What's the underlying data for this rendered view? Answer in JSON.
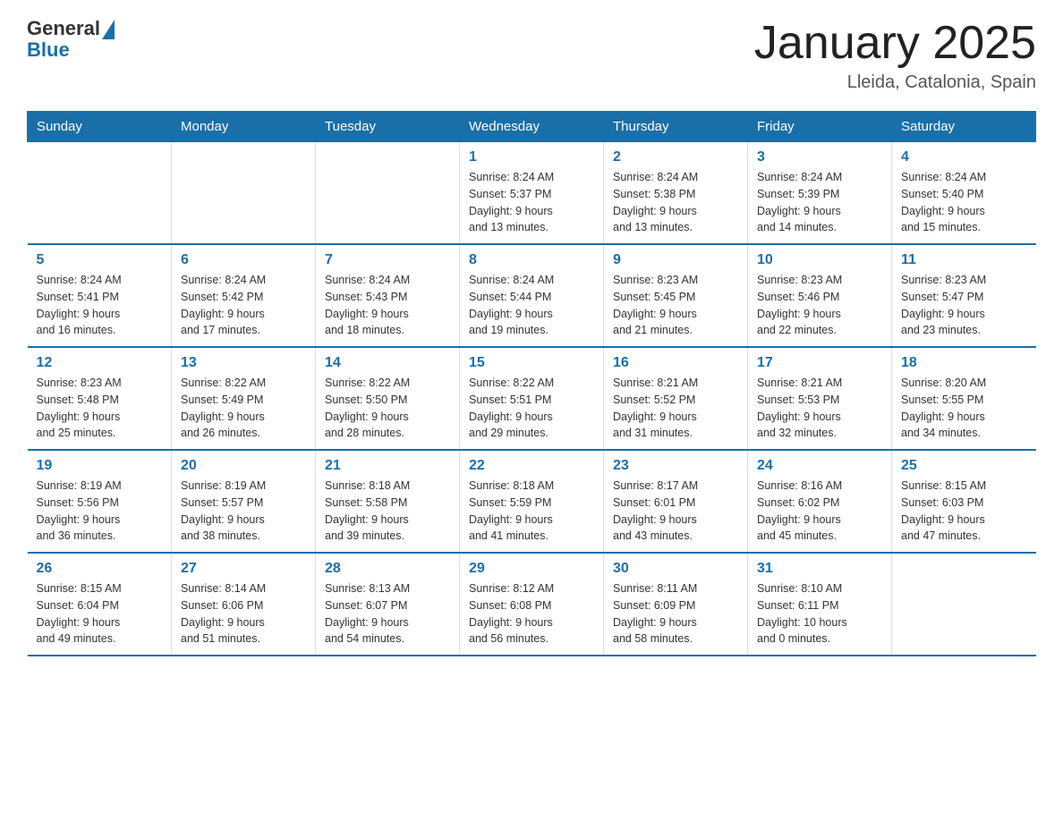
{
  "header": {
    "logo_general": "General",
    "logo_blue": "Blue",
    "main_title": "January 2025",
    "subtitle": "Lleida, Catalonia, Spain"
  },
  "calendar": {
    "days_of_week": [
      "Sunday",
      "Monday",
      "Tuesday",
      "Wednesday",
      "Thursday",
      "Friday",
      "Saturday"
    ],
    "weeks": [
      [
        {
          "day": "",
          "info": ""
        },
        {
          "day": "",
          "info": ""
        },
        {
          "day": "",
          "info": ""
        },
        {
          "day": "1",
          "info": "Sunrise: 8:24 AM\nSunset: 5:37 PM\nDaylight: 9 hours\nand 13 minutes."
        },
        {
          "day": "2",
          "info": "Sunrise: 8:24 AM\nSunset: 5:38 PM\nDaylight: 9 hours\nand 13 minutes."
        },
        {
          "day": "3",
          "info": "Sunrise: 8:24 AM\nSunset: 5:39 PM\nDaylight: 9 hours\nand 14 minutes."
        },
        {
          "day": "4",
          "info": "Sunrise: 8:24 AM\nSunset: 5:40 PM\nDaylight: 9 hours\nand 15 minutes."
        }
      ],
      [
        {
          "day": "5",
          "info": "Sunrise: 8:24 AM\nSunset: 5:41 PM\nDaylight: 9 hours\nand 16 minutes."
        },
        {
          "day": "6",
          "info": "Sunrise: 8:24 AM\nSunset: 5:42 PM\nDaylight: 9 hours\nand 17 minutes."
        },
        {
          "day": "7",
          "info": "Sunrise: 8:24 AM\nSunset: 5:43 PM\nDaylight: 9 hours\nand 18 minutes."
        },
        {
          "day": "8",
          "info": "Sunrise: 8:24 AM\nSunset: 5:44 PM\nDaylight: 9 hours\nand 19 minutes."
        },
        {
          "day": "9",
          "info": "Sunrise: 8:23 AM\nSunset: 5:45 PM\nDaylight: 9 hours\nand 21 minutes."
        },
        {
          "day": "10",
          "info": "Sunrise: 8:23 AM\nSunset: 5:46 PM\nDaylight: 9 hours\nand 22 minutes."
        },
        {
          "day": "11",
          "info": "Sunrise: 8:23 AM\nSunset: 5:47 PM\nDaylight: 9 hours\nand 23 minutes."
        }
      ],
      [
        {
          "day": "12",
          "info": "Sunrise: 8:23 AM\nSunset: 5:48 PM\nDaylight: 9 hours\nand 25 minutes."
        },
        {
          "day": "13",
          "info": "Sunrise: 8:22 AM\nSunset: 5:49 PM\nDaylight: 9 hours\nand 26 minutes."
        },
        {
          "day": "14",
          "info": "Sunrise: 8:22 AM\nSunset: 5:50 PM\nDaylight: 9 hours\nand 28 minutes."
        },
        {
          "day": "15",
          "info": "Sunrise: 8:22 AM\nSunset: 5:51 PM\nDaylight: 9 hours\nand 29 minutes."
        },
        {
          "day": "16",
          "info": "Sunrise: 8:21 AM\nSunset: 5:52 PM\nDaylight: 9 hours\nand 31 minutes."
        },
        {
          "day": "17",
          "info": "Sunrise: 8:21 AM\nSunset: 5:53 PM\nDaylight: 9 hours\nand 32 minutes."
        },
        {
          "day": "18",
          "info": "Sunrise: 8:20 AM\nSunset: 5:55 PM\nDaylight: 9 hours\nand 34 minutes."
        }
      ],
      [
        {
          "day": "19",
          "info": "Sunrise: 8:19 AM\nSunset: 5:56 PM\nDaylight: 9 hours\nand 36 minutes."
        },
        {
          "day": "20",
          "info": "Sunrise: 8:19 AM\nSunset: 5:57 PM\nDaylight: 9 hours\nand 38 minutes."
        },
        {
          "day": "21",
          "info": "Sunrise: 8:18 AM\nSunset: 5:58 PM\nDaylight: 9 hours\nand 39 minutes."
        },
        {
          "day": "22",
          "info": "Sunrise: 8:18 AM\nSunset: 5:59 PM\nDaylight: 9 hours\nand 41 minutes."
        },
        {
          "day": "23",
          "info": "Sunrise: 8:17 AM\nSunset: 6:01 PM\nDaylight: 9 hours\nand 43 minutes."
        },
        {
          "day": "24",
          "info": "Sunrise: 8:16 AM\nSunset: 6:02 PM\nDaylight: 9 hours\nand 45 minutes."
        },
        {
          "day": "25",
          "info": "Sunrise: 8:15 AM\nSunset: 6:03 PM\nDaylight: 9 hours\nand 47 minutes."
        }
      ],
      [
        {
          "day": "26",
          "info": "Sunrise: 8:15 AM\nSunset: 6:04 PM\nDaylight: 9 hours\nand 49 minutes."
        },
        {
          "day": "27",
          "info": "Sunrise: 8:14 AM\nSunset: 6:06 PM\nDaylight: 9 hours\nand 51 minutes."
        },
        {
          "day": "28",
          "info": "Sunrise: 8:13 AM\nSunset: 6:07 PM\nDaylight: 9 hours\nand 54 minutes."
        },
        {
          "day": "29",
          "info": "Sunrise: 8:12 AM\nSunset: 6:08 PM\nDaylight: 9 hours\nand 56 minutes."
        },
        {
          "day": "30",
          "info": "Sunrise: 8:11 AM\nSunset: 6:09 PM\nDaylight: 9 hours\nand 58 minutes."
        },
        {
          "day": "31",
          "info": "Sunrise: 8:10 AM\nSunset: 6:11 PM\nDaylight: 10 hours\nand 0 minutes."
        },
        {
          "day": "",
          "info": ""
        }
      ]
    ]
  }
}
